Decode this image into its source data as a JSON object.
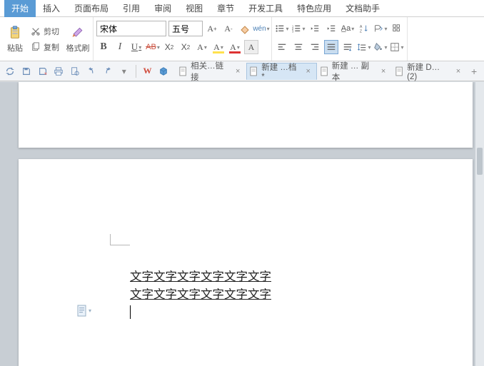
{
  "menu": {
    "tabs": [
      "开始",
      "插入",
      "页面布局",
      "引用",
      "审阅",
      "视图",
      "章节",
      "开发工具",
      "特色应用",
      "文档助手"
    ],
    "activeIndex": 0
  },
  "ribbon": {
    "paste": "粘贴",
    "cut": "剪切",
    "copy": "复制",
    "formatPainter": "格式刷",
    "fontName": "宋体",
    "fontSize": "五号"
  },
  "docTabs": {
    "items": [
      {
        "label": "相关…链接",
        "modified": false,
        "active": false
      },
      {
        "label": "新建 …档 *",
        "modified": true,
        "active": true
      },
      {
        "label": "新建 … 副本",
        "modified": false,
        "active": false
      },
      {
        "label": "新建 D… (2)",
        "modified": false,
        "active": false
      }
    ]
  },
  "document": {
    "line1": "文字文字文字文字文字文字",
    "line2": "文字文字文字文字文字文字"
  },
  "icons": {
    "paste": "clipboard",
    "cut": "scissors",
    "copy": "copy",
    "eraser": "eraser",
    "bold": "B",
    "italic": "I",
    "underline": "U",
    "strike": "ab",
    "super": "X²",
    "sub": "X₂",
    "wps": "W",
    "cube": "cube",
    "doc": "doc"
  }
}
